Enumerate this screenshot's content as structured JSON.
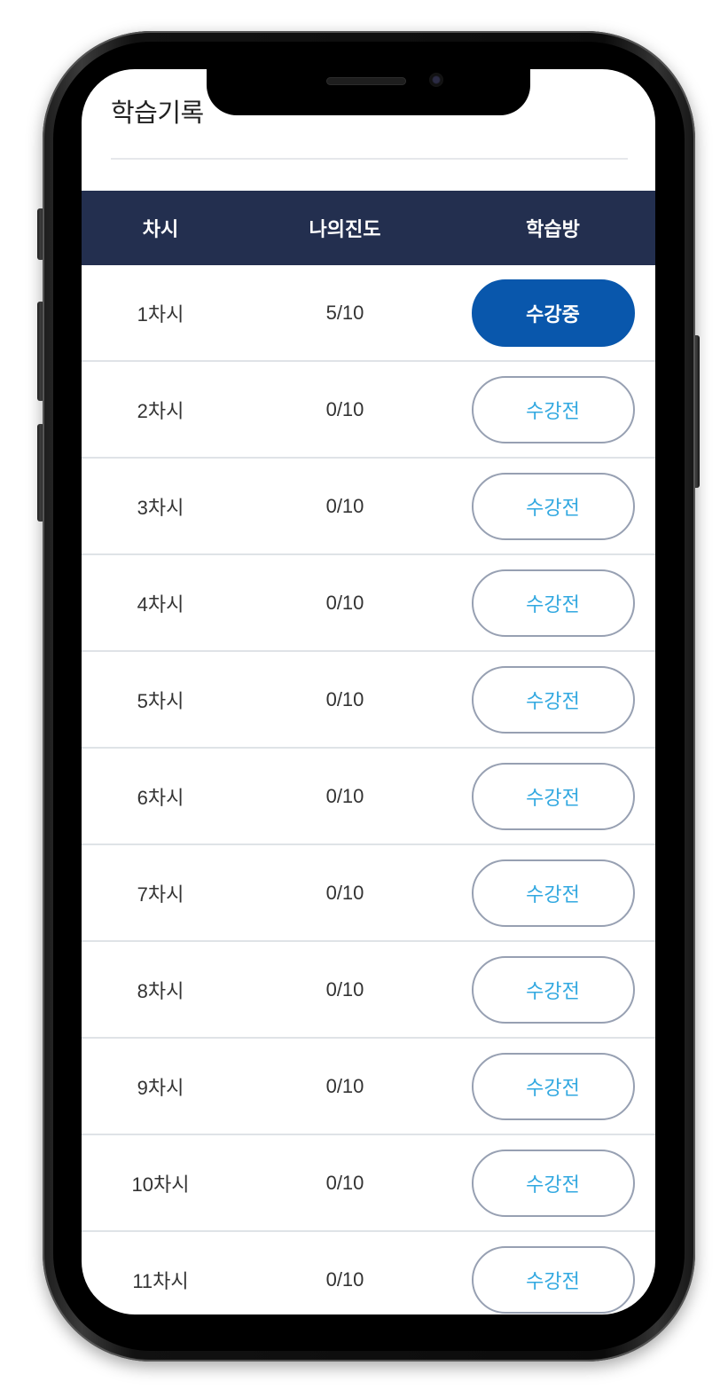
{
  "page": {
    "title": "학습기록"
  },
  "table": {
    "headers": {
      "session": "차시",
      "progress": "나의진도",
      "room": "학습방"
    },
    "rows": [
      {
        "session": "1차시",
        "progress": "5/10",
        "status": "수강중",
        "active": true
      },
      {
        "session": "2차시",
        "progress": "0/10",
        "status": "수강전",
        "active": false
      },
      {
        "session": "3차시",
        "progress": "0/10",
        "status": "수강전",
        "active": false
      },
      {
        "session": "4차시",
        "progress": "0/10",
        "status": "수강전",
        "active": false
      },
      {
        "session": "5차시",
        "progress": "0/10",
        "status": "수강전",
        "active": false
      },
      {
        "session": "6차시",
        "progress": "0/10",
        "status": "수강전",
        "active": false
      },
      {
        "session": "7차시",
        "progress": "0/10",
        "status": "수강전",
        "active": false
      },
      {
        "session": "8차시",
        "progress": "0/10",
        "status": "수강전",
        "active": false
      },
      {
        "session": "9차시",
        "progress": "0/10",
        "status": "수강전",
        "active": false
      },
      {
        "session": "10차시",
        "progress": "0/10",
        "status": "수강전",
        "active": false
      },
      {
        "session": "11차시",
        "progress": "0/10",
        "status": "수강전",
        "active": false
      }
    ]
  },
  "colors": {
    "header_bg": "#232f4f",
    "active_button": "#0957ac",
    "idle_button_text": "#31a8e0",
    "idle_button_border": "#97a0b2"
  }
}
